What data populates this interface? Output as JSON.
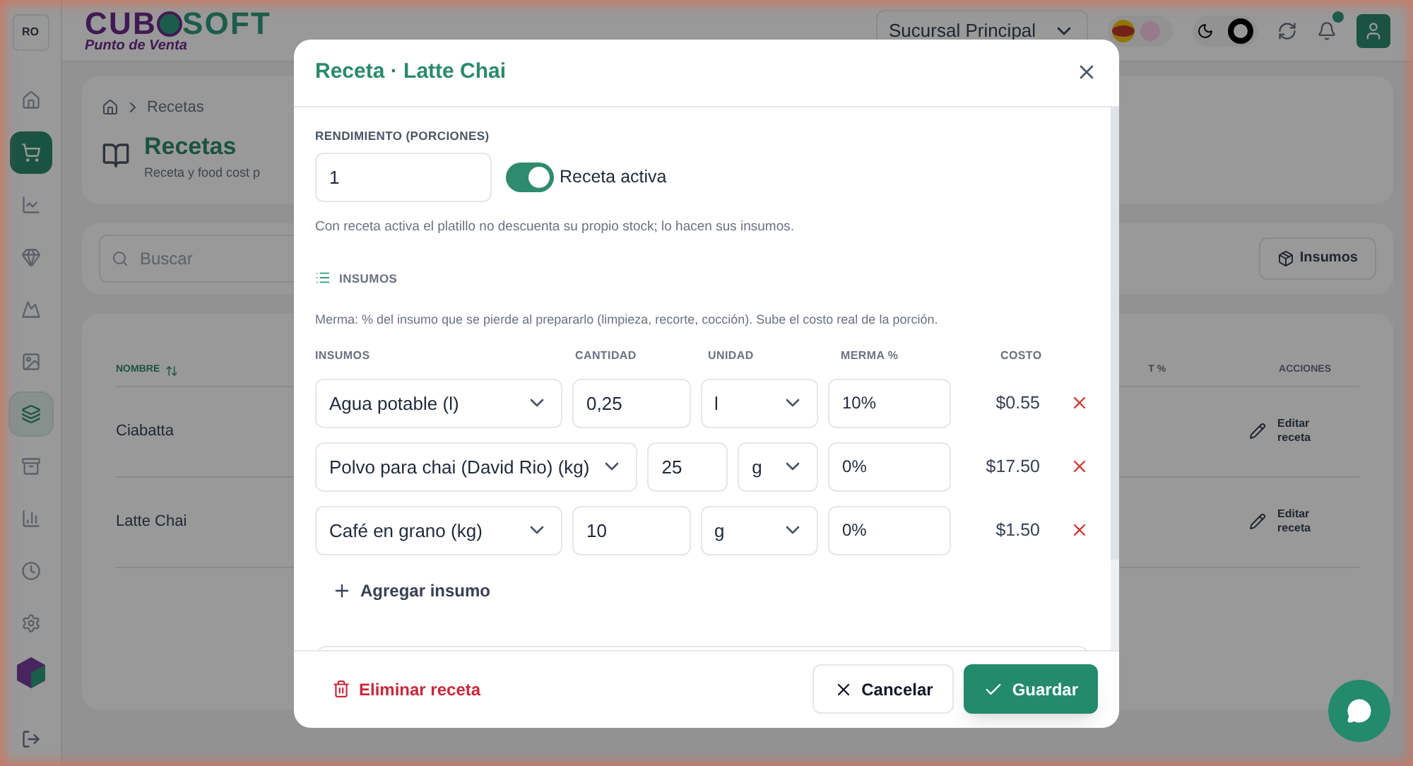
{
  "app": {
    "logo_left": "CUB",
    "logo_right": "SOFT",
    "tagline": "Punto de Venta",
    "user_badge": "RO"
  },
  "sidebar": [
    {
      "selected": false,
      "current": false
    },
    {
      "selected": true,
      "current": false
    },
    {
      "selected": false,
      "current": false
    },
    {
      "selected": false,
      "current": false
    },
    {
      "selected": false,
      "current": false
    },
    {
      "selected": false,
      "current": false
    },
    {
      "selected": false,
      "current": true
    },
    {
      "selected": false,
      "current": false
    },
    {
      "selected": false,
      "current": false
    },
    {
      "selected": false,
      "current": false
    },
    {
      "selected": false,
      "current": false
    }
  ],
  "topbar": {
    "branch": "Sucursal Principal",
    "notifications": true,
    "language_toggle": {
      "on": false
    },
    "theme_toggle": {
      "on": true
    }
  },
  "page": {
    "breadcrumb": "Recetas",
    "title": "Recetas",
    "subtitle": "Receta y food cost p",
    "search_placeholder": "Buscar",
    "insumos_button": "Insumos",
    "columns": [
      "NOMBRE",
      "T %",
      "ACCIONES"
    ],
    "rows": [
      {
        "name": "Ciabatta",
        "action": "Editar receta"
      },
      {
        "name": "Latte Chai",
        "action": "Editar receta"
      }
    ]
  },
  "modal": {
    "title": "Receta · Latte Chai",
    "yield_label": "RENDIMIENTO (PORCIONES)",
    "yield_value": "1",
    "active": {
      "label": "Receta activa",
      "on": true
    },
    "active_hint": "Con receta activa el platillo no descuenta su propio stock; lo hacen sus insumos.",
    "section": "INSUMOS",
    "merma_note": "Merma: % del insumo que se pierde al prepararlo (limpieza, recorte, cocción). Sube el costo real de la porción.",
    "columns": [
      "INSUMOS",
      "CANTIDAD",
      "UNIDAD",
      "MERMA %",
      "COSTO"
    ],
    "rows": [
      {
        "insumo": "Agua potable (l)",
        "cantidad": "0,25",
        "unidad": "l",
        "merma": "10%",
        "costo": "$0.55"
      },
      {
        "insumo": "Polvo para chai (David Rio) (kg)",
        "cantidad": "25",
        "unidad": "g",
        "merma": "0%",
        "costo": "$17.50"
      },
      {
        "insumo": "Café en grano (kg)",
        "cantidad": "10",
        "unidad": "g",
        "merma": "0%",
        "costo": "$1.50"
      }
    ],
    "add_button": "Agregar insumo",
    "delete_button": "Eliminar receta",
    "cancel_button": "Cancelar",
    "save_button": "Guardar"
  }
}
